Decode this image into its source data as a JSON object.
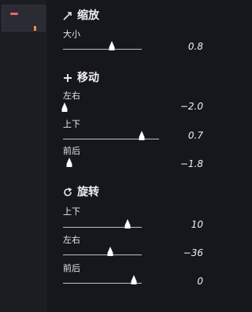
{
  "thumbnail": {
    "name": "preview"
  },
  "sections": {
    "scale": {
      "title": "缩放",
      "icon": "diagonal-arrow-icon",
      "controls": {
        "size": {
          "label": "大小",
          "value": "0.8",
          "fraction": 0.62
        }
      }
    },
    "move": {
      "title": "移动",
      "icon": "plus-icon",
      "controls": {
        "lr": {
          "label": "左右",
          "value": "−2.0",
          "fraction": 0.02
        },
        "ud": {
          "label": "上下",
          "value": "0.7",
          "fraction": 0.82
        },
        "fb": {
          "label": "前后",
          "value": "−1.8",
          "fraction": 0.08
        }
      }
    },
    "rotate": {
      "title": "旋转",
      "icon": "refresh-icon",
      "controls": {
        "ud": {
          "label": "上下",
          "value": "10",
          "fraction": 0.82
        },
        "lr": {
          "label": "左右",
          "value": "−36",
          "fraction": 0.6
        },
        "fb": {
          "label": "前后",
          "value": "0",
          "fraction": 0.9
        }
      }
    }
  },
  "colors": {
    "background": "#16171d",
    "track": "#bfc0c6",
    "handle": "#ffffff"
  }
}
